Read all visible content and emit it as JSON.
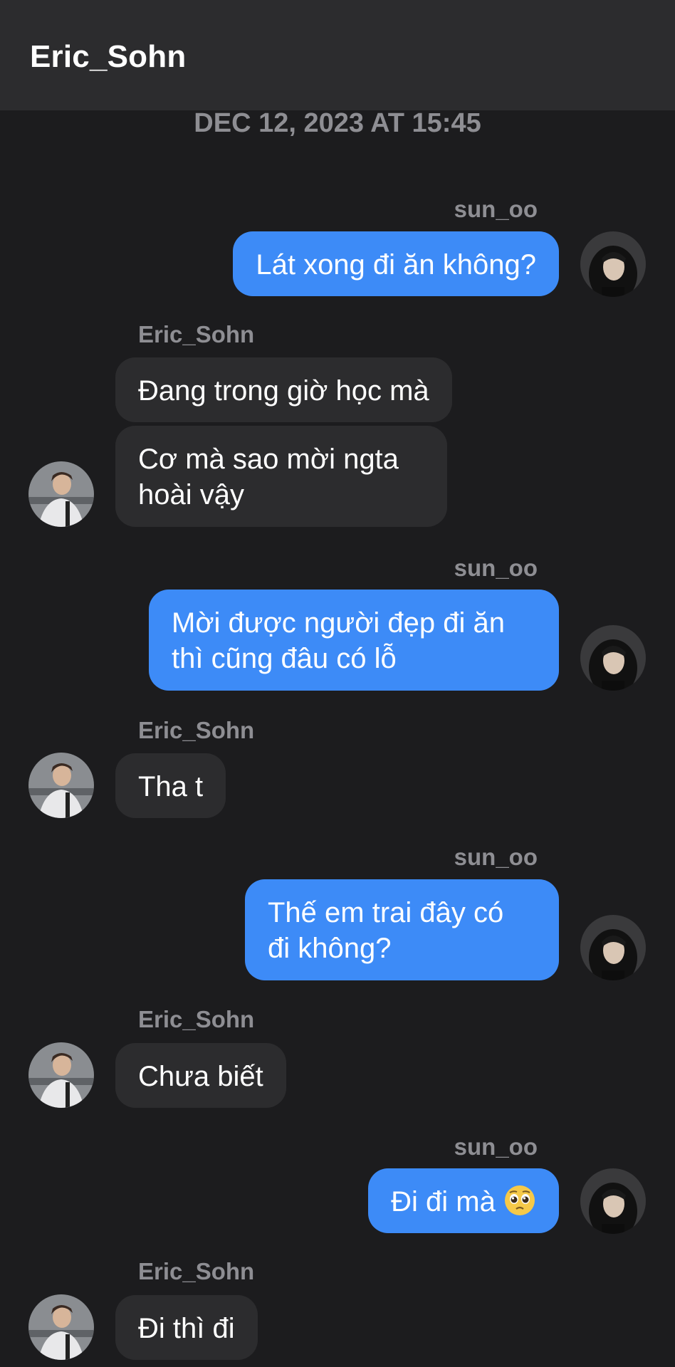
{
  "header": {
    "title": "Eric_Sohn"
  },
  "timestamp": "DEC 12, 2023 AT 15:45",
  "users": {
    "me": "sun_oo",
    "other": "Eric_Sohn"
  },
  "messages": [
    {
      "sender": "sun_oo",
      "text": "Lát xong đi ăn không?"
    },
    {
      "sender": "Eric_Sohn",
      "text": "Đang trong giờ học mà"
    },
    {
      "sender": "Eric_Sohn",
      "line1": "Cơ mà sao mời ngta",
      "line2": "hoài vậy"
    },
    {
      "sender": "sun_oo",
      "line1": "Mời được người đẹp đi ăn",
      "line2": "thì cũng đâu có lỗ"
    },
    {
      "sender": "Eric_Sohn",
      "text": "Tha t"
    },
    {
      "sender": "sun_oo",
      "line1": "Thế em trai đây có",
      "line2": "đi không?"
    },
    {
      "sender": "Eric_Sohn",
      "text": "Chưa biết"
    },
    {
      "sender": "sun_oo",
      "text": "Đi đi mà",
      "emoji": "pleading-face"
    },
    {
      "sender": "Eric_Sohn",
      "text": "Đi thì đi"
    }
  ],
  "colors": {
    "background": "#1c1c1e",
    "header": "#2c2c2e",
    "outgoing_bubble": "#3d8bf7",
    "incoming_bubble": "#2c2c2e",
    "meta_text": "#8e8e93"
  }
}
